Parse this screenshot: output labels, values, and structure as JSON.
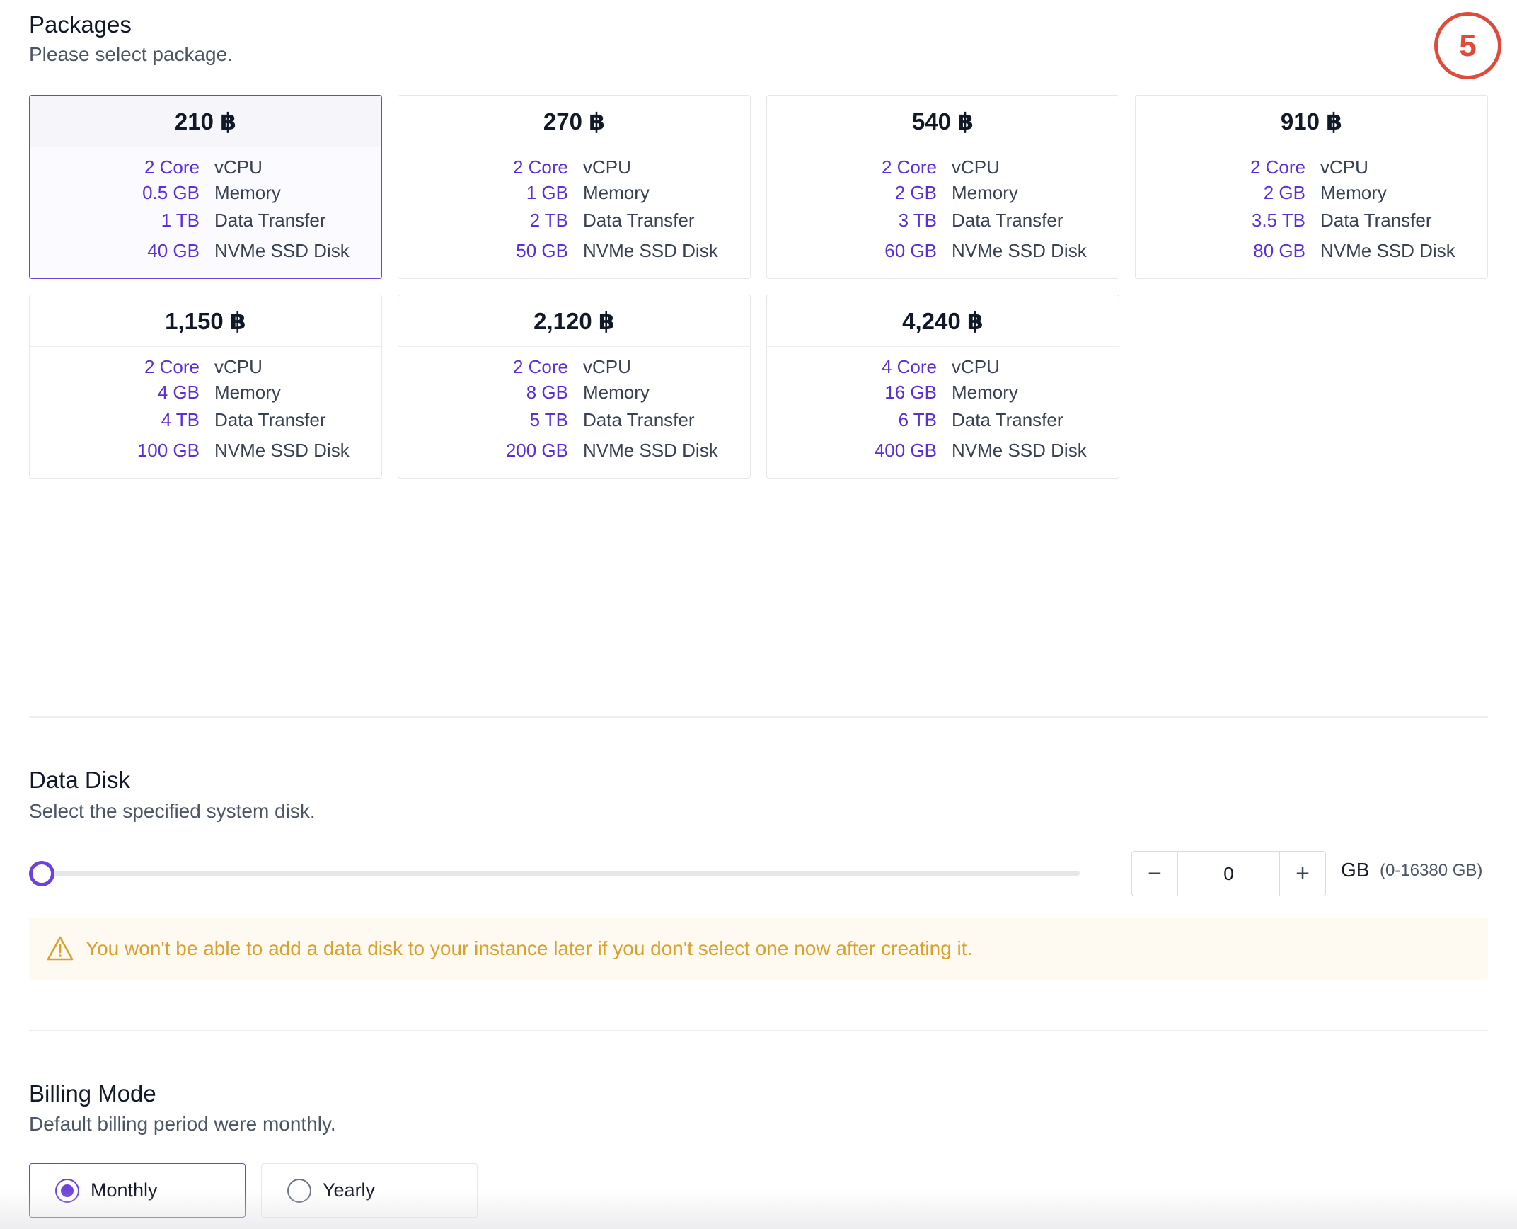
{
  "packages": {
    "title": "Packages",
    "subtitle": "Please select package.",
    "items": [
      {
        "price": "210 ฿",
        "specs": [
          {
            "value": "2 Core",
            "label": "vCPU"
          },
          {
            "value": "0.5 GB",
            "label": "Memory"
          },
          {
            "value": "1 TB",
            "label": "Data Transfer"
          },
          {
            "value": "40 GB",
            "label": "NVMe SSD Disk"
          }
        ]
      },
      {
        "price": "270 ฿",
        "specs": [
          {
            "value": "2 Core",
            "label": "vCPU"
          },
          {
            "value": "1 GB",
            "label": "Memory"
          },
          {
            "value": "2 TB",
            "label": "Data Transfer"
          },
          {
            "value": "50 GB",
            "label": "NVMe SSD Disk"
          }
        ]
      },
      {
        "price": "540 ฿",
        "specs": [
          {
            "value": "2 Core",
            "label": "vCPU"
          },
          {
            "value": "2 GB",
            "label": "Memory"
          },
          {
            "value": "3 TB",
            "label": "Data Transfer"
          },
          {
            "value": "60 GB",
            "label": "NVMe SSD Disk"
          }
        ]
      },
      {
        "price": "910 ฿",
        "specs": [
          {
            "value": "2 Core",
            "label": "vCPU"
          },
          {
            "value": "2 GB",
            "label": "Memory"
          },
          {
            "value": "3.5 TB",
            "label": "Data Transfer"
          },
          {
            "value": "80 GB",
            "label": "NVMe SSD Disk"
          }
        ]
      },
      {
        "price": "1,150 ฿",
        "specs": [
          {
            "value": "2 Core",
            "label": "vCPU"
          },
          {
            "value": "4 GB",
            "label": "Memory"
          },
          {
            "value": "4 TB",
            "label": "Data Transfer"
          },
          {
            "value": "100 GB",
            "label": "NVMe SSD Disk"
          }
        ]
      },
      {
        "price": "2,120 ฿",
        "specs": [
          {
            "value": "2 Core",
            "label": "vCPU"
          },
          {
            "value": "8 GB",
            "label": "Memory"
          },
          {
            "value": "5 TB",
            "label": "Data Transfer"
          },
          {
            "value": "200 GB",
            "label": "NVMe SSD Disk"
          }
        ]
      },
      {
        "price": "4,240 ฿",
        "specs": [
          {
            "value": "4 Core",
            "label": "vCPU"
          },
          {
            "value": "16 GB",
            "label": "Memory"
          },
          {
            "value": "6 TB",
            "label": "Data Transfer"
          },
          {
            "value": "400 GB",
            "label": "NVMe SSD Disk"
          }
        ]
      }
    ]
  },
  "step_badge": "5",
  "data_disk": {
    "title": "Data Disk",
    "subtitle": "Select the specified system disk.",
    "slider_fraction": 0,
    "value": "0",
    "minus_symbol": "−",
    "plus_symbol": "+",
    "unit": "GB",
    "range": "(0-16380 GB)",
    "warning": "You won't be able to add a data disk to your instance later if you don't select one now after creating it."
  },
  "billing": {
    "title": "Billing Mode",
    "subtitle": "Default billing period were monthly.",
    "options": [
      {
        "label": "Monthly"
      },
      {
        "label": "Yearly"
      }
    ]
  },
  "colors": {
    "accent": "#6d42d8",
    "warning_text": "#d9a02e",
    "warning_bg": "#fffaf1",
    "badge": "#e04a3a"
  },
  "icons": {
    "warning": "warning-triangle-icon"
  }
}
